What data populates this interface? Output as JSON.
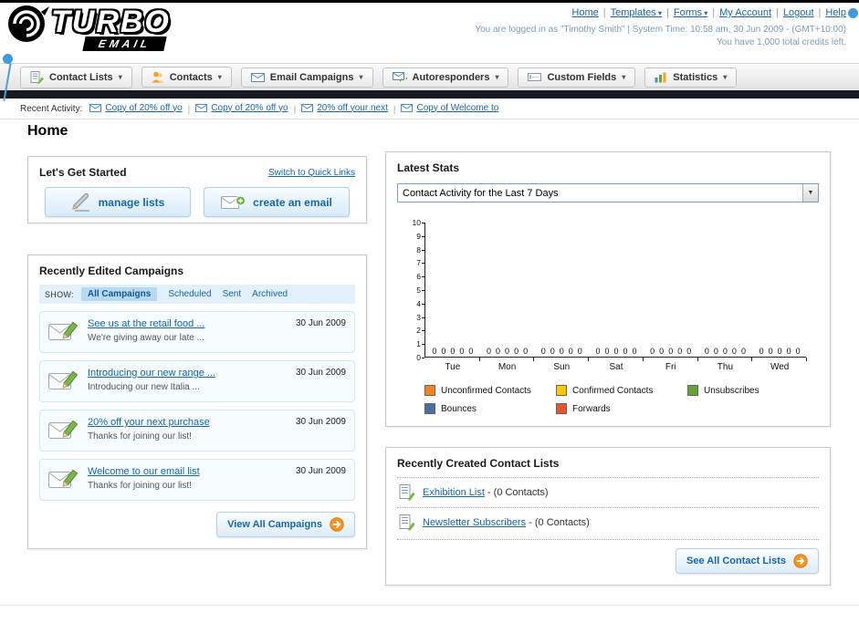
{
  "header": {
    "logo_text_top": "TURBO",
    "logo_text_bottom": "EMAIL",
    "nav_links": [
      {
        "label": "Home",
        "caret": false
      },
      {
        "label": "Templates",
        "caret": true
      },
      {
        "label": "Forms",
        "caret": true
      },
      {
        "label": "My Account",
        "caret": false
      },
      {
        "label": "Logout",
        "caret": false
      },
      {
        "label": "Help",
        "caret": false
      }
    ],
    "login_info": "You are logged in as \"Timothy Smith\" | System Time: 10:58 am, 30 Jun 2009 - (GMT+10:00)",
    "credits_info": "You have 1,000 total credits left."
  },
  "main_nav": {
    "items": [
      {
        "label": "Contact Lists",
        "icon": "contact-lists-icon"
      },
      {
        "label": "Contacts",
        "icon": "contacts-icon"
      },
      {
        "label": "Email Campaigns",
        "icon": "email-campaigns-icon"
      },
      {
        "label": "Autoresponders",
        "icon": "autoresponders-icon"
      },
      {
        "label": "Custom Fields",
        "icon": "custom-fields-icon"
      },
      {
        "label": "Statistics",
        "icon": "statistics-icon"
      }
    ]
  },
  "recent_activity": {
    "label": "Recent Activity:",
    "items": [
      "Copy of 20% off yo",
      "Copy of 20% off yo",
      "20% off your next",
      "Copy of Welcome to"
    ]
  },
  "page_title": "Home",
  "get_started": {
    "title": "Let's Get Started",
    "switch_link": "Switch to Quick Links",
    "buttons": [
      {
        "label": "manage lists",
        "icon": "manage-lists-icon"
      },
      {
        "label": "create an email",
        "icon": "create-email-icon"
      }
    ]
  },
  "campaigns": {
    "title": "Recently Edited Campaigns",
    "show_label": "SHOW:",
    "tabs": [
      "All Campaigns",
      "Scheduled",
      "Sent",
      "Archived"
    ],
    "selected_tab": "All Campaigns",
    "items": [
      {
        "title": "See us at the retail food ...",
        "subtitle": "We're giving away our late ...",
        "date": "30 Jun 2009"
      },
      {
        "title": "Introducing our new range ...",
        "subtitle": "Introducing our new Italia ...",
        "date": "30 Jun 2009"
      },
      {
        "title": "20% off your next purchase",
        "subtitle": "Thanks for joining our list!",
        "date": "30 Jun 2009"
      },
      {
        "title": "Welcome to our email list",
        "subtitle": "Thanks for joining our list!",
        "date": "30 Jun 2009"
      }
    ],
    "view_all_label": "View All Campaigns"
  },
  "stats": {
    "title": "Latest Stats",
    "dropdown_value": "Contact Activity for the Last 7 Days",
    "chart_data": {
      "type": "bar",
      "title": "Contact Activity for the Last 7 Days",
      "categories": [
        "Tue",
        "Mon",
        "Sun",
        "Sat",
        "Fri",
        "Thu",
        "Wed"
      ],
      "series": [
        {
          "name": "Unconfirmed Contacts",
          "color": "#f58220",
          "values": [
            0,
            0,
            0,
            0,
            0,
            0,
            0
          ]
        },
        {
          "name": "Confirmed Contacts",
          "color": "#fdc800",
          "values": [
            0,
            0,
            0,
            0,
            0,
            0,
            0
          ]
        },
        {
          "name": "Unsubscribes",
          "color": "#64a233",
          "values": [
            0,
            0,
            0,
            0,
            0,
            0,
            0
          ]
        },
        {
          "name": "Bounces",
          "color": "#4a6f9e",
          "values": [
            0,
            0,
            0,
            0,
            0,
            0,
            0
          ]
        },
        {
          "name": "Forwards",
          "color": "#e8552c",
          "values": [
            0,
            0,
            0,
            0,
            0,
            0,
            0
          ]
        }
      ],
      "ylim": [
        0,
        10
      ],
      "yticks": [
        0,
        1,
        2,
        3,
        4,
        5,
        6,
        7,
        8,
        9,
        10
      ],
      "grid": false,
      "legend_position": "bottom",
      "value_labels_shown": true
    }
  },
  "contact_lists": {
    "title": "Recently Created Contact Lists",
    "items": [
      {
        "name": "Exhibition List",
        "suffix": " - (0 Contacts)"
      },
      {
        "name": "Newsletter Subscribers",
        "suffix": " - (0 Contacts)"
      }
    ],
    "see_all_label": "See All Contact Lists"
  }
}
